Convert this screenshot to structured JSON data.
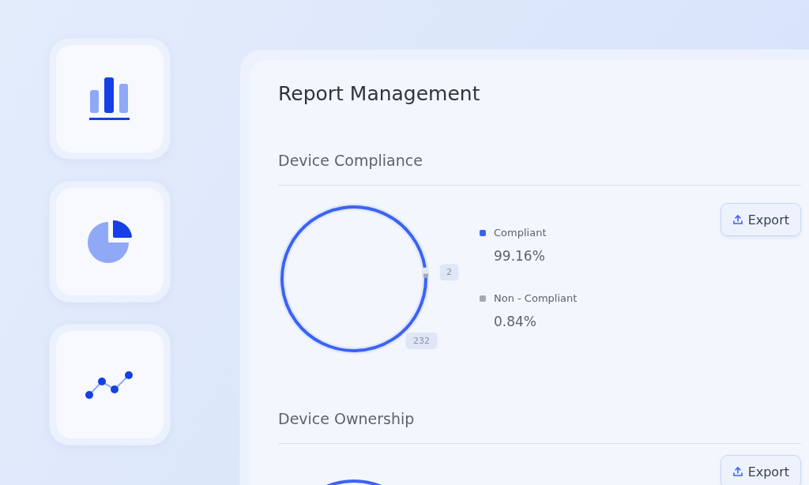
{
  "sidebar": {
    "tiles": [
      {
        "kind": "bar"
      },
      {
        "kind": "pie"
      },
      {
        "kind": "line"
      }
    ]
  },
  "panel": {
    "title": "Report Management",
    "sections": [
      {
        "heading": "Device Compliance",
        "export_label": "Export",
        "kind": "donut",
        "slices": [
          {
            "value": "232",
            "color": "#3b63f3"
          },
          {
            "value": "2",
            "color": "#a4a8b0"
          }
        ],
        "legend": [
          {
            "label": "Compliant",
            "percent": "99.16%",
            "color": "#3b63f3"
          },
          {
            "label": "Non - Compliant",
            "percent": "0.84%",
            "color": "#a4a8b0"
          }
        ]
      },
      {
        "heading": "Device Ownership",
        "export_label": "Export",
        "kind": "partial"
      }
    ]
  }
}
